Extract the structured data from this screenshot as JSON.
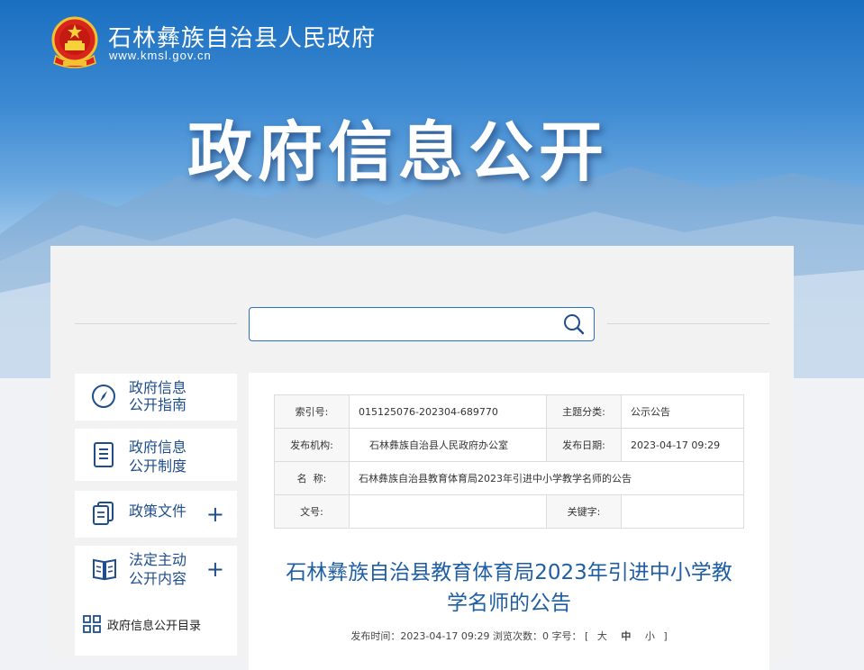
{
  "header": {
    "gov_name": "石林彝族自治县人民政府",
    "url": "www.kmsl.gov.cn",
    "banner_title": "政府信息公开"
  },
  "search": {
    "placeholder": "",
    "value": ""
  },
  "sidebar": {
    "items": [
      {
        "line1": "政府信息",
        "line2": "公开指南",
        "icon": "compass-icon",
        "expandable": false
      },
      {
        "line1": "政府信息",
        "line2": "公开制度",
        "icon": "document-icon",
        "expandable": false
      },
      {
        "line1": "政策文件",
        "line2": "",
        "icon": "files-icon",
        "expandable": true,
        "plus": "+"
      },
      {
        "line1": "法定主动",
        "line2": "公开内容",
        "icon": "book-icon",
        "expandable": true,
        "plus": "+"
      }
    ],
    "sub_item": {
      "label": "政府信息公开目录",
      "icon": "grid-icon"
    }
  },
  "meta": {
    "index_no_label": "索引号:",
    "index_no": "015125076-202304-689770",
    "category_label": "主题分类:",
    "category": "公示公告",
    "publisher_label": "发布机构:",
    "publisher": "石林彝族自治县人民政府办公室",
    "pub_date_label": "发布日期:",
    "pub_date": "2023-04-17 09:29",
    "name_label": "名  称:",
    "name": "石林彝族自治县教育体育局2023年引进中小学教学名师的公告",
    "doc_no_label": "文号:",
    "doc_no": "",
    "keywords_label": "关键字:",
    "keywords": ""
  },
  "article": {
    "title_line1": "石林彝族自治县教育体育局2023年引进中小学教",
    "title_line2": "学名师的公告",
    "publish_label": "发布时间：",
    "publish_time": "2023-04-17 09:29",
    "views_label": "浏览次数：",
    "views": "0",
    "fontsize_label": "字号：",
    "bracket_open": "[",
    "size_large": "大",
    "size_medium": "中",
    "size_small": "小",
    "bracket_close": "]"
  },
  "colors": {
    "primary": "#1f4e8c",
    "accent": "#2a6fbf",
    "title": "#1f5ea3"
  }
}
